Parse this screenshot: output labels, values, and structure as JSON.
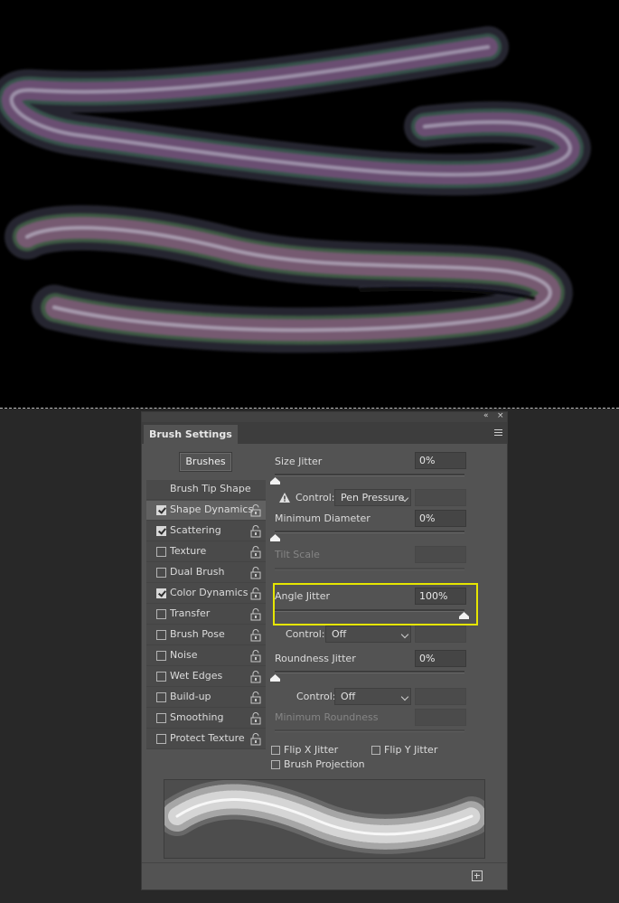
{
  "panel": {
    "title": "Brush Settings",
    "collapse_glyph": "«",
    "close_glyph": "×",
    "menu_icon": "panel-menu-icon"
  },
  "brushes_button": "Brushes",
  "sidebar": {
    "items": [
      {
        "label": "Brush Tip Shape",
        "checkbox": false,
        "checked": false,
        "selected": false,
        "lock": false
      },
      {
        "label": "Shape Dynamics",
        "checkbox": true,
        "checked": true,
        "selected": true,
        "lock": true
      },
      {
        "label": "Scattering",
        "checkbox": true,
        "checked": true,
        "selected": false,
        "lock": true
      },
      {
        "label": "Texture",
        "checkbox": true,
        "checked": false,
        "selected": false,
        "lock": true
      },
      {
        "label": "Dual Brush",
        "checkbox": true,
        "checked": false,
        "selected": false,
        "lock": true
      },
      {
        "label": "Color Dynamics",
        "checkbox": true,
        "checked": true,
        "selected": false,
        "lock": true
      },
      {
        "label": "Transfer",
        "checkbox": true,
        "checked": false,
        "selected": false,
        "lock": true
      },
      {
        "label": "Brush Pose",
        "checkbox": true,
        "checked": false,
        "selected": false,
        "lock": true
      },
      {
        "label": "Noise",
        "checkbox": true,
        "checked": false,
        "selected": false,
        "lock": true
      },
      {
        "label": "Wet Edges",
        "checkbox": true,
        "checked": false,
        "selected": false,
        "lock": true
      },
      {
        "label": "Build-up",
        "checkbox": true,
        "checked": false,
        "selected": false,
        "lock": true
      },
      {
        "label": "Smoothing",
        "checkbox": true,
        "checked": false,
        "selected": false,
        "lock": true
      },
      {
        "label": "Protect Texture",
        "checkbox": true,
        "checked": false,
        "selected": false,
        "lock": true
      }
    ]
  },
  "settings": {
    "size_jitter": {
      "label": "Size Jitter",
      "value": "0%",
      "level": 0
    },
    "size_control": {
      "label": "Control:",
      "value": "Pen Pressure"
    },
    "min_diameter": {
      "label": "Minimum Diameter",
      "value": "0%",
      "level": 0
    },
    "tilt_scale": {
      "label": "Tilt Scale",
      "value": ""
    },
    "angle_jitter": {
      "label": "Angle Jitter",
      "value": "100%",
      "level": 1
    },
    "angle_control": {
      "label": "Control:",
      "value": "Off"
    },
    "roundness_jitter": {
      "label": "Roundness Jitter",
      "value": "0%",
      "level": 0
    },
    "roundness_control": {
      "label": "Control:",
      "value": "Off"
    },
    "min_roundness": {
      "label": "Minimum Roundness",
      "value": ""
    },
    "flip_x": {
      "label": "Flip X Jitter",
      "checked": false
    },
    "flip_y": {
      "label": "Flip Y Jitter",
      "checked": false
    },
    "brush_projection": {
      "label": "Brush Projection",
      "checked": false
    }
  },
  "colors": {
    "highlight": "#e6e600",
    "canvas": "#000000",
    "panel": "#535353"
  }
}
